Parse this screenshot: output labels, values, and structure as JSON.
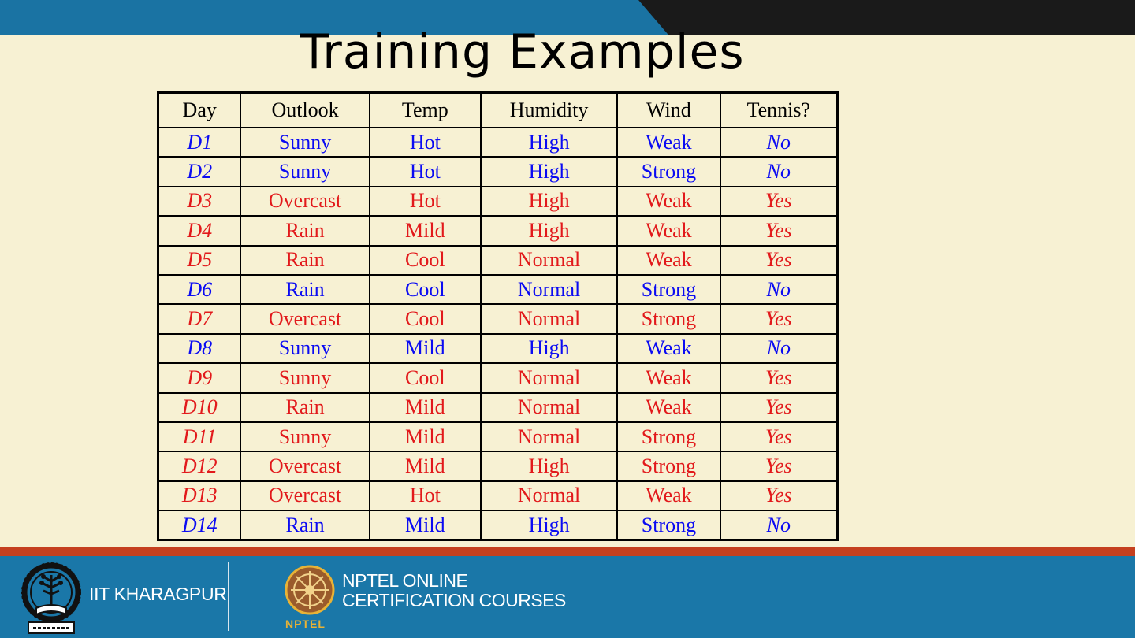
{
  "slide": {
    "title": "Training Examples"
  },
  "colors": {
    "negative_row": "#0b0bf2",
    "positive_row": "#e2191b",
    "background": "#f7f1d3",
    "top_bar": "#1a73a3",
    "footer": "#1a77a8",
    "footer_stripe": "#c5401f"
  },
  "table": {
    "headers": [
      "Day",
      "Outlook",
      "Temp",
      "Humidity",
      "Wind",
      "Tennis?"
    ],
    "rows": [
      {
        "day": "D1",
        "outlook": "Sunny",
        "temp": "Hot",
        "humidity": "High",
        "wind": "Weak",
        "tennis": "No",
        "class": "blue"
      },
      {
        "day": "D2",
        "outlook": "Sunny",
        "temp": "Hot",
        "humidity": "High",
        "wind": "Strong",
        "tennis": "No",
        "class": "blue"
      },
      {
        "day": "D3",
        "outlook": "Overcast",
        "temp": "Hot",
        "humidity": "High",
        "wind": "Weak",
        "tennis": "Yes",
        "class": "red"
      },
      {
        "day": "D4",
        "outlook": "Rain",
        "temp": "Mild",
        "humidity": "High",
        "wind": "Weak",
        "tennis": "Yes",
        "class": "red"
      },
      {
        "day": "D5",
        "outlook": "Rain",
        "temp": "Cool",
        "humidity": "Normal",
        "wind": "Weak",
        "tennis": "Yes",
        "class": "red"
      },
      {
        "day": "D6",
        "outlook": "Rain",
        "temp": "Cool",
        "humidity": "Normal",
        "wind": "Strong",
        "tennis": "No",
        "class": "blue"
      },
      {
        "day": "D7",
        "outlook": "Overcast",
        "temp": "Cool",
        "humidity": "Normal",
        "wind": "Strong",
        "tennis": "Yes",
        "class": "red"
      },
      {
        "day": "D8",
        "outlook": "Sunny",
        "temp": "Mild",
        "humidity": "High",
        "wind": "Weak",
        "tennis": "No",
        "class": "blue"
      },
      {
        "day": "D9",
        "outlook": "Sunny",
        "temp": "Cool",
        "humidity": "Normal",
        "wind": "Weak",
        "tennis": "Yes",
        "class": "red"
      },
      {
        "day": "D10",
        "outlook": "Rain",
        "temp": "Mild",
        "humidity": "Normal",
        "wind": "Weak",
        "tennis": "Yes",
        "class": "red"
      },
      {
        "day": "D11",
        "outlook": "Sunny",
        "temp": "Mild",
        "humidity": "Normal",
        "wind": "Strong",
        "tennis": "Yes",
        "class": "red"
      },
      {
        "day": "D12",
        "outlook": "Overcast",
        "temp": "Mild",
        "humidity": "High",
        "wind": "Strong",
        "tennis": "Yes",
        "class": "red"
      },
      {
        "day": "D13",
        "outlook": "Overcast",
        "temp": "Hot",
        "humidity": "Normal",
        "wind": "Weak",
        "tennis": "Yes",
        "class": "red"
      },
      {
        "day": "D14",
        "outlook": "Rain",
        "temp": "Mild",
        "humidity": "High",
        "wind": "Strong",
        "tennis": "No",
        "class": "blue"
      }
    ]
  },
  "footer": {
    "iit_logo_icon": "iit-kharagpur-emblem",
    "iit_label": "IIT KHARAGPUR",
    "nptel_logo_icon": "nptel-wheel-emblem",
    "nptel_line1": "NPTEL ONLINE",
    "nptel_line2": "CERTIFICATION COURSES",
    "nptel_small": "NPTEL"
  }
}
